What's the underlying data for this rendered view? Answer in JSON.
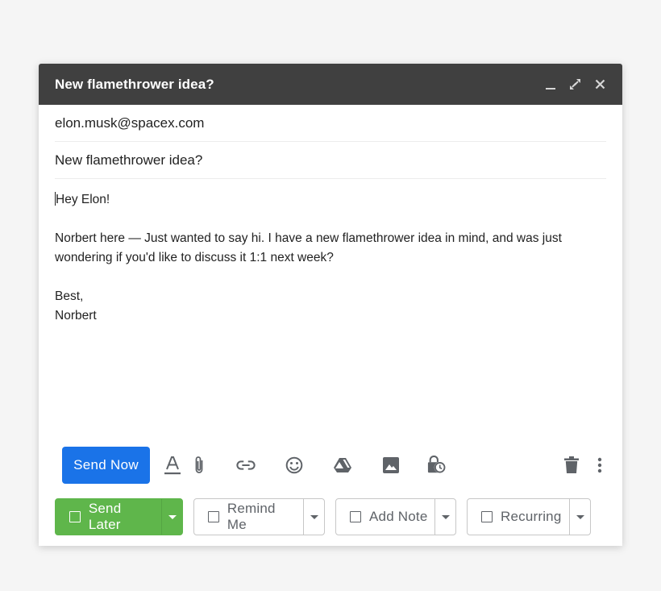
{
  "window": {
    "title": "New flamethrower idea?"
  },
  "fields": {
    "to": "elon.musk@spacex.com",
    "subject": "New flamethrower idea?"
  },
  "body": {
    "greeting": "Hey Elon!",
    "paragraph": "Norbert here — Just wanted to say hi. I have a new flamethrower idea in mind, and was just wondering if you'd like to discuss it 1:1 next week?",
    "closing": "Best,",
    "signature": "Norbert"
  },
  "toolbar": {
    "send_now_label": "Send Now",
    "send_now_color": "#1a73e8",
    "icons": [
      "format-text-icon",
      "attach-icon",
      "link-icon",
      "emoji-icon",
      "drive-icon",
      "photo-icon",
      "schedule-lock-icon",
      "trash-icon",
      "more-vert-icon"
    ]
  },
  "actions": {
    "send_later_label": "Send Later",
    "send_later_color": "#5fb64b",
    "remind_me_label": "Remind Me",
    "add_note_label": "Add Note",
    "recurring_label": "Recurring"
  }
}
